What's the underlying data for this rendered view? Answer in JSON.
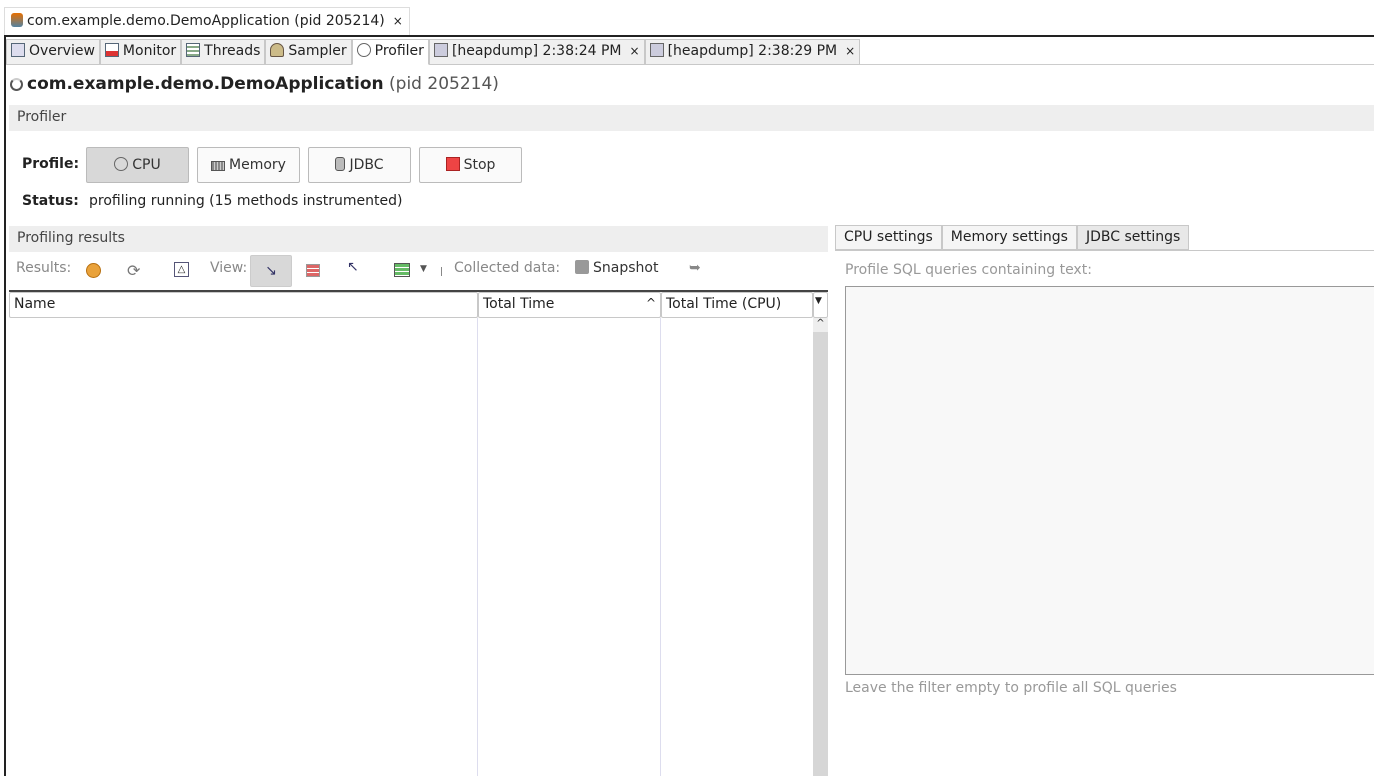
{
  "window_tab": {
    "title": "com.example.demo.DemoApplication (pid 205214)",
    "close": "×"
  },
  "tabs": [
    {
      "label": "Overview",
      "icon": "overview-icon"
    },
    {
      "label": "Monitor",
      "icon": "monitor-icon"
    },
    {
      "label": "Threads",
      "icon": "threads-icon"
    },
    {
      "label": "Sampler",
      "icon": "sampler-icon"
    },
    {
      "label": "Profiler",
      "icon": "profiler-icon",
      "active": true
    },
    {
      "label": "[heapdump] 2:38:24 PM",
      "icon": "heapdump-icon",
      "close": "×"
    },
    {
      "label": "[heapdump] 2:38:29 PM",
      "icon": "heapdump-icon",
      "close": "×"
    }
  ],
  "app": {
    "name": "com.example.demo.DemoApplication",
    "pid": "(pid 205214)"
  },
  "profiler": {
    "header": "Profiler",
    "profile_label": "Profile:",
    "cpu": "CPU",
    "memory": "Memory",
    "jdbc": "JDBC",
    "stop": "Stop",
    "status_label": "Status:",
    "status": "profiling running (15 methods instrumented)"
  },
  "results": {
    "header": "Profiling results",
    "results_label": "Results:",
    "view_label": "View:",
    "collected_label": "Collected data:",
    "snapshot": "Snapshot",
    "columns": [
      "Name",
      "Total Time",
      "Total Time (CPU)"
    ],
    "sort_indicator": "^"
  },
  "settings": {
    "tabs": [
      "CPU settings",
      "Memory settings",
      "JDBC settings"
    ],
    "filter_label": "Profile SQL queries containing text:",
    "filter_value": "",
    "hint": "Leave the filter empty to profile all SQL queries"
  }
}
